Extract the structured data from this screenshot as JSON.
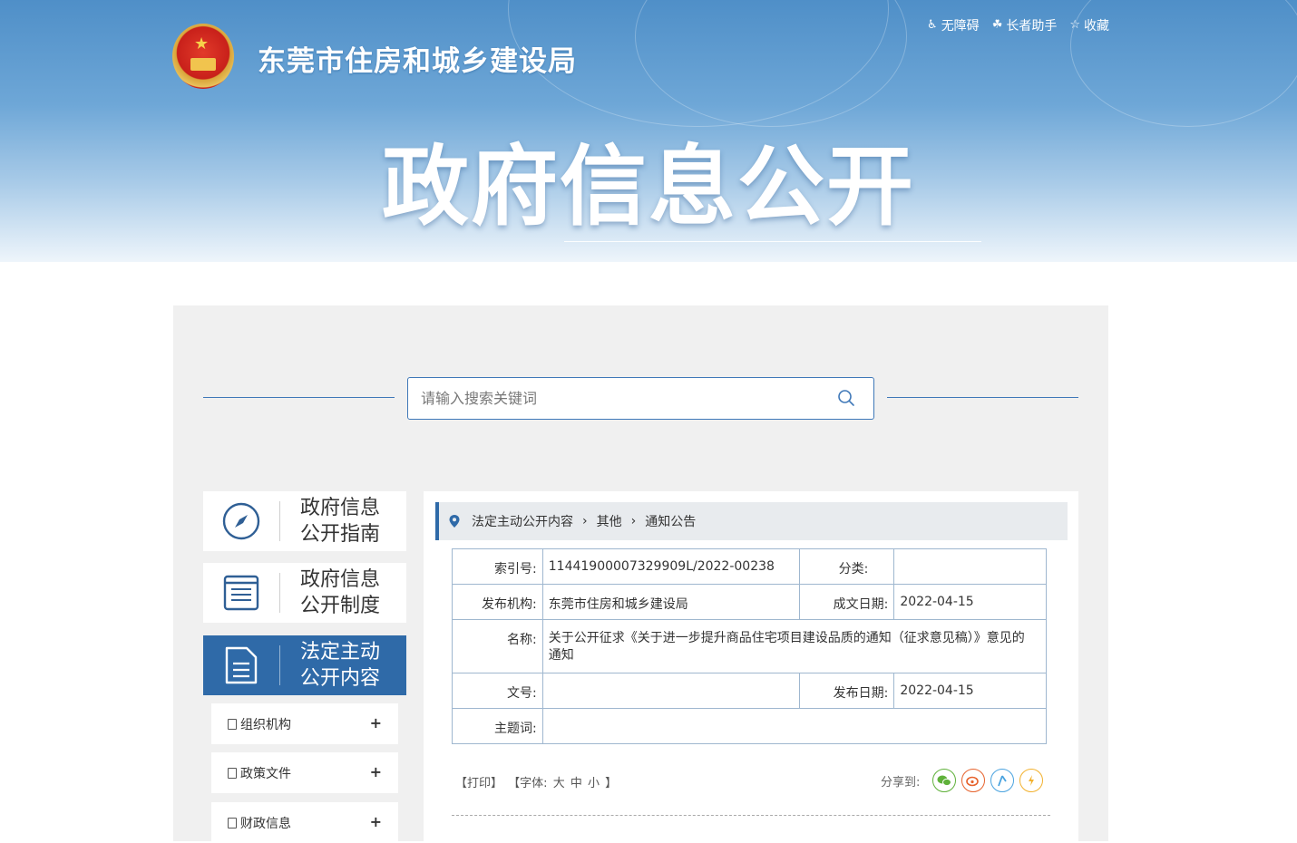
{
  "header": {
    "site_title": "东莞市住房和城乡建设局",
    "big_title": "政府信息公开",
    "links": [
      {
        "icon": "accessibility-icon",
        "label": "无障碍"
      },
      {
        "icon": "elder-helper-icon",
        "label": "长者助手"
      },
      {
        "icon": "star-icon",
        "label": "收藏"
      }
    ]
  },
  "search": {
    "placeholder": "请输入搜索关键词"
  },
  "nav": {
    "cards": [
      {
        "label_line1": "政府信息",
        "label_line2": "公开指南",
        "icon": "compass-icon",
        "active": false
      },
      {
        "label_line1": "政府信息",
        "label_line2": "公开制度",
        "icon": "list-book-icon",
        "active": false
      },
      {
        "label_line1": "法定主动",
        "label_line2": "公开内容",
        "icon": "document-icon",
        "active": true
      }
    ],
    "sub_items": [
      {
        "label": "组织机构"
      },
      {
        "label": "政策文件"
      },
      {
        "label": "财政信息"
      }
    ]
  },
  "breadcrumb": {
    "items": [
      "法定主动公开内容",
      "其他",
      "通知公告"
    ]
  },
  "meta": {
    "index_label": "索引号:",
    "index_value": "11441900007329909L/2022-00238",
    "category_label": "分类:",
    "category_value": "",
    "publisher_label": "发布机构:",
    "publisher_value": "东莞市住房和城乡建设局",
    "created_label": "成文日期:",
    "created_value": "2022-04-15",
    "name_label": "名称:",
    "name_value": "关于公开征求《关于进一步提升商品住宅项目建设品质的通知（征求意见稿）》意见的通知",
    "docno_label": "文号:",
    "docno_value": "",
    "published_label": "发布日期:",
    "published_value": "2022-04-15",
    "keywords_label": "主题词:",
    "keywords_value": ""
  },
  "tools": {
    "print": "【打印】",
    "font_prefix": "【字体:",
    "font_large": "大",
    "font_medium": "中",
    "font_small": "小",
    "font_suffix": "】",
    "share_label": "分享到:"
  },
  "colors": {
    "accent": "#2f6aa8",
    "panel_bg": "#f0f0f0"
  }
}
